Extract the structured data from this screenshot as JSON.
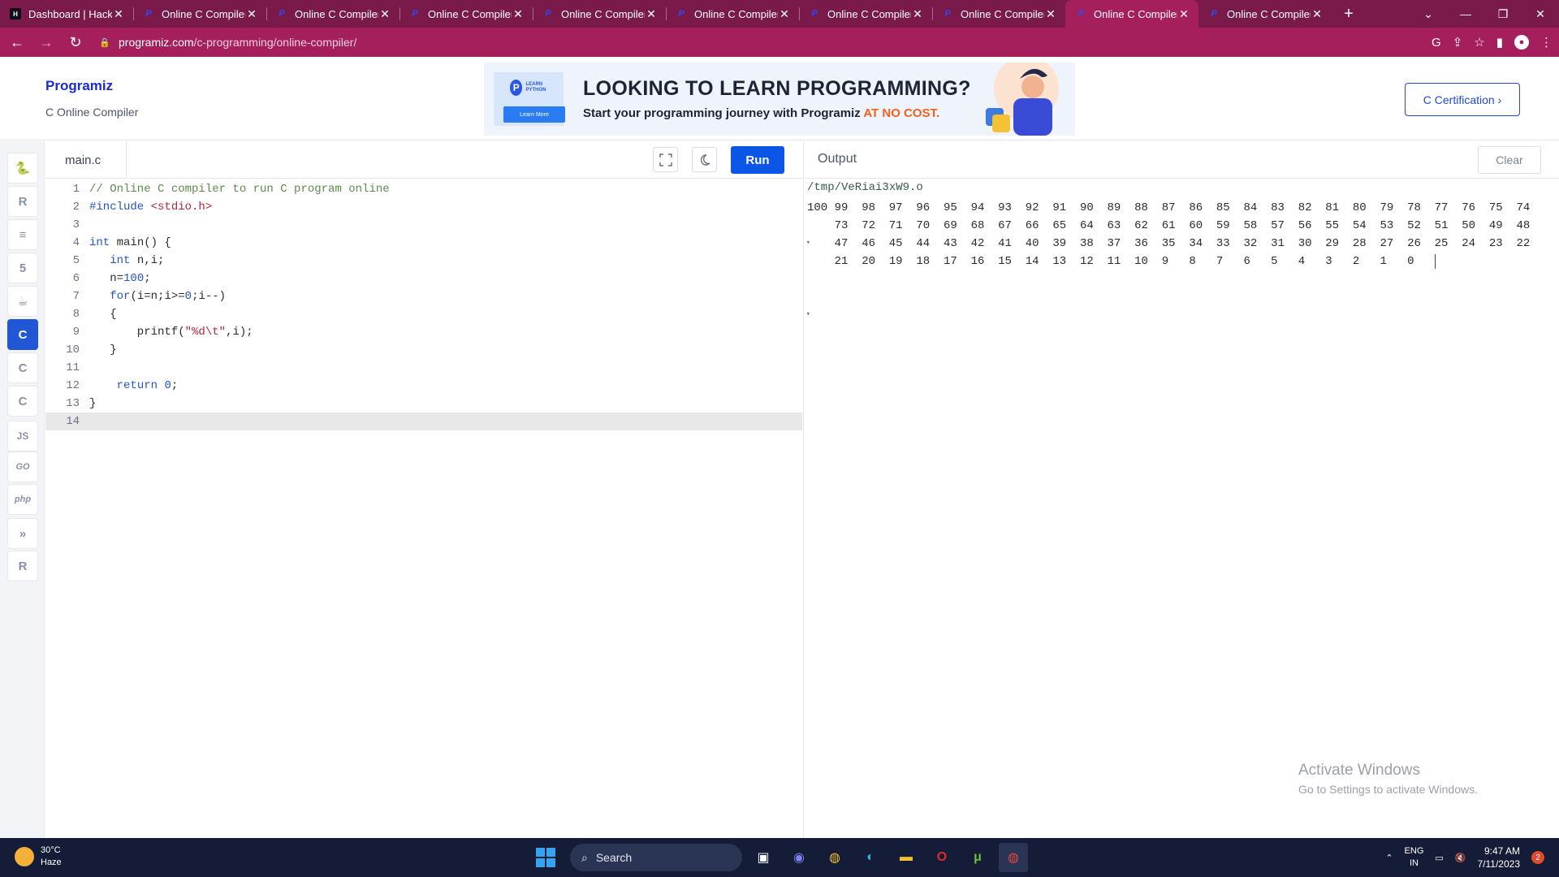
{
  "browser": {
    "tabs": [
      {
        "title": "Dashboard | HackerRank",
        "icon": "hackerrank-favicon",
        "active": false
      },
      {
        "title": "Online C Compiler",
        "icon": "programiz-favicon",
        "active": false
      },
      {
        "title": "Online C Compiler",
        "icon": "programiz-favicon",
        "active": false
      },
      {
        "title": "Online C Compiler",
        "icon": "programiz-favicon",
        "active": false
      },
      {
        "title": "Online C Compiler",
        "icon": "programiz-favicon",
        "active": false
      },
      {
        "title": "Online C Compiler",
        "icon": "programiz-favicon",
        "active": false
      },
      {
        "title": "Online C Compiler",
        "icon": "programiz-favicon",
        "active": false
      },
      {
        "title": "Online C Compiler",
        "icon": "programiz-favicon",
        "active": false
      },
      {
        "title": "Online C Compiler",
        "icon": "programiz-favicon",
        "active": true
      },
      {
        "title": "Online C Compiler",
        "icon": "programiz-favicon",
        "active": false
      }
    ],
    "url_host": "programiz.com",
    "url_path": "/c-programming/online-compiler/",
    "colors": {
      "tabbar": "#7a1a4a",
      "toolbar": "#a61f5d"
    }
  },
  "header": {
    "logo": "Programiz",
    "subtitle": "C Online Compiler",
    "banner": {
      "badge": "LEARN PYTHON",
      "learn_more": "Learn More",
      "title": "LOOKING TO LEARN PROGRAMMING?",
      "sub_prefix": "Start your programming journey with Programiz ",
      "sub_highlight": "AT NO COST."
    },
    "cert_button": "C Certification ›"
  },
  "sidebar": {
    "languages": [
      {
        "name": "python",
        "glyph": "🐍",
        "active": false
      },
      {
        "name": "r",
        "glyph": "R",
        "active": false
      },
      {
        "name": "sql",
        "glyph": "≡",
        "active": false
      },
      {
        "name": "html",
        "glyph": "5",
        "active": false
      },
      {
        "name": "java",
        "glyph": "☕",
        "active": false
      },
      {
        "name": "c",
        "glyph": "C",
        "active": true
      },
      {
        "name": "cpp",
        "glyph": "C",
        "active": false
      },
      {
        "name": "csharp",
        "glyph": "C",
        "active": false
      },
      {
        "name": "javascript",
        "glyph": "JS",
        "active": false
      },
      {
        "name": "go",
        "glyph": "GO",
        "active": false
      },
      {
        "name": "php",
        "glyph": "php",
        "active": false
      },
      {
        "name": "swift",
        "glyph": "»",
        "active": false
      },
      {
        "name": "rust",
        "glyph": "R",
        "active": false
      }
    ]
  },
  "editor": {
    "filename": "main.c",
    "run_label": "Run",
    "current_line": 14,
    "lines": [
      {
        "n": "1",
        "fold": false,
        "html": "<span class=\"tk-c\">// Online C compiler to run C program online</span>"
      },
      {
        "n": "2",
        "fold": false,
        "html": "<span class=\"tk-kw\">#include</span> <span class=\"tk-str\">&lt;stdio.h&gt;</span>"
      },
      {
        "n": "3",
        "fold": false,
        "html": ""
      },
      {
        "n": "4",
        "fold": true,
        "html": "<span class=\"tk-kw\">int</span> main() {"
      },
      {
        "n": "5",
        "fold": false,
        "html": "   <span class=\"tk-kw\">int</span> n,i;"
      },
      {
        "n": "6",
        "fold": false,
        "html": "   n=<span class=\"tk-num\">100</span>;"
      },
      {
        "n": "7",
        "fold": false,
        "html": "   <span class=\"tk-kw\">for</span>(i=n;i&gt;=<span class=\"tk-num\">0</span>;i--)"
      },
      {
        "n": "8",
        "fold": true,
        "html": "   {"
      },
      {
        "n": "9",
        "fold": false,
        "html": "       printf(<span class=\"tk-str\">\"%d\\t\"</span>,i);"
      },
      {
        "n": "10",
        "fold": false,
        "html": "   }"
      },
      {
        "n": "11",
        "fold": false,
        "html": ""
      },
      {
        "n": "12",
        "fold": false,
        "html": "    <span class=\"tk-kw\">return</span> <span class=\"tk-num\">0</span>;"
      },
      {
        "n": "13",
        "fold": false,
        "html": "}"
      },
      {
        "n": "14",
        "fold": false,
        "html": ""
      }
    ]
  },
  "output": {
    "label": "Output",
    "clear_label": "Clear",
    "path": "/tmp/VeRiai3xW9.o",
    "rows": [
      [
        "100",
        "99",
        "98",
        "97",
        "96",
        "95",
        "94",
        "93",
        "92",
        "91",
        "90",
        "89",
        "88",
        "87",
        "86",
        "85",
        "84",
        "83",
        "82",
        "81",
        "80",
        "79",
        "78",
        "77",
        "76",
        "75",
        "74"
      ],
      [
        "",
        "73",
        "72",
        "71",
        "70",
        "69",
        "68",
        "67",
        "66",
        "65",
        "64",
        "63",
        "62",
        "61",
        "60",
        "59",
        "58",
        "57",
        "56",
        "55",
        "54",
        "53",
        "52",
        "51",
        "50",
        "49",
        "48"
      ],
      [
        "",
        "47",
        "46",
        "45",
        "44",
        "43",
        "42",
        "41",
        "40",
        "39",
        "38",
        "37",
        "36",
        "35",
        "34",
        "33",
        "32",
        "31",
        "30",
        "29",
        "28",
        "27",
        "26",
        "25",
        "24",
        "23",
        "22"
      ],
      [
        "",
        "21",
        "20",
        "19",
        "18",
        "17",
        "16",
        "15",
        "14",
        "13",
        "12",
        "11",
        "10",
        "9",
        "8",
        "7",
        "6",
        "5",
        "4",
        "3",
        "2",
        "1",
        "0"
      ]
    ]
  },
  "watermark": {
    "line1": "Activate Windows",
    "line2": "Go to Settings to activate Windows."
  },
  "taskbar": {
    "weather_temp": "30°C",
    "weather_desc": "Haze",
    "search_placeholder": "Search",
    "language": "ENG",
    "region": "IN",
    "time": "9:47 AM",
    "date": "7/11/2023",
    "notifications": "2"
  }
}
